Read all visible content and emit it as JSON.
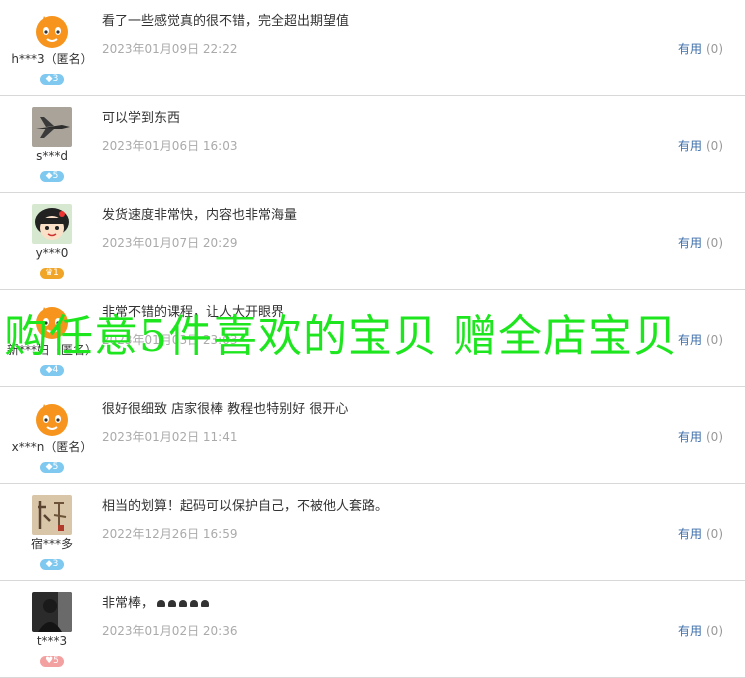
{
  "reviews": [
    {
      "user": "h***3（匿名）",
      "avatar": "orange-mascot",
      "badge_type": "diamond",
      "badge": "3",
      "content": "看了一些感觉真的很不错，完全超出期望值",
      "date": "2023年01月09日 22:22",
      "helpful_label": "有用",
      "helpful_count": "(0)"
    },
    {
      "user": "s***d",
      "avatar": "jet-plane",
      "badge_type": "diamond",
      "badge": "5",
      "content": "可以学到东西",
      "date": "2023年01月06日 16:03",
      "helpful_label": "有用",
      "helpful_count": "(0)"
    },
    {
      "user": "y***0",
      "avatar": "cartoon-girl",
      "badge_type": "crown",
      "badge": "1",
      "content": "发货速度非常快，内容也非常海量",
      "date": "2023年01月07日 20:29",
      "helpful_label": "有用",
      "helpful_count": "(0)"
    },
    {
      "user": "新***妇（匿名）",
      "avatar": "orange-mascot",
      "badge_type": "diamond",
      "badge": "4",
      "content": "非常不错的课程，让人大开眼界",
      "date": "2023年01月03日 23:03",
      "helpful_label": "有用",
      "helpful_count": "(0)"
    },
    {
      "user": "x***n（匿名）",
      "avatar": "orange-mascot",
      "badge_type": "diamond",
      "badge": "5",
      "content": "很好很细致 店家很棒 教程也特别好 很开心",
      "date": "2023年01月02日 11:41",
      "helpful_label": "有用",
      "helpful_count": "(0)"
    },
    {
      "user": "宿***多",
      "avatar": "calligraphy",
      "badge_type": "diamond",
      "badge": "3",
      "content": "相当的划算！起码可以保护自己，不被他人套路。",
      "date": "2022年12月26日 16:59",
      "helpful_label": "有用",
      "helpful_count": "(0)"
    },
    {
      "user": "t***3",
      "avatar": "dark-photo",
      "badge_type": "heart",
      "badge": "5",
      "content": "非常棒，",
      "date": "2023年01月02日 20:36",
      "helpful_label": "有用",
      "helpful_count": "(0)"
    }
  ],
  "overlay_text": "购任意5件喜欢的宝贝  赠全店宝贝"
}
